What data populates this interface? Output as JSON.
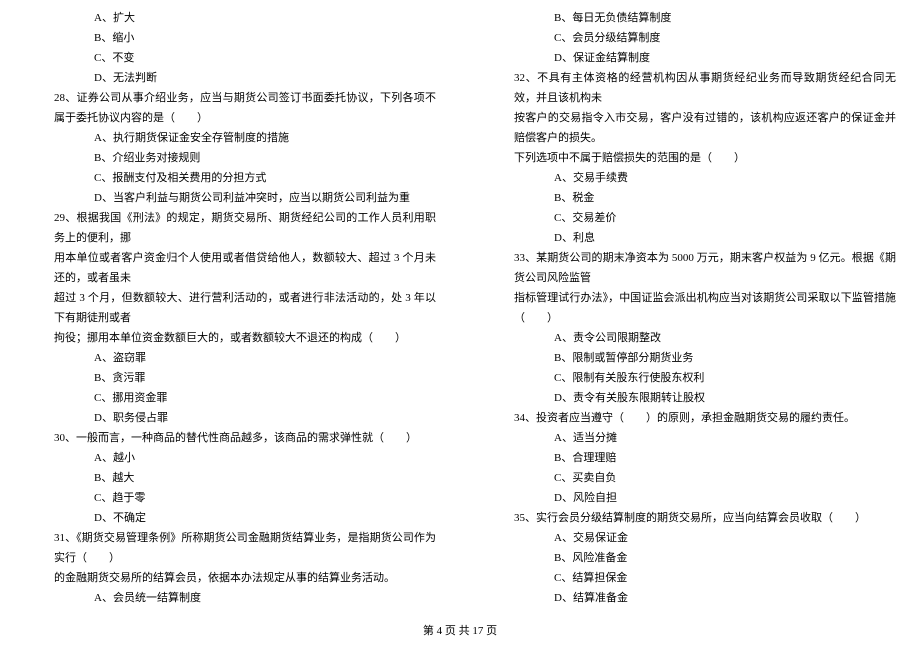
{
  "left_column": {
    "q27_options": [
      "A、扩大",
      "B、缩小",
      "C、不变",
      "D、无法判断"
    ],
    "q28": {
      "text": "28、证券公司从事介绍业务，应当与期货公司签订书面委托协议，下列各项不属于委托协议内容的是（　　）",
      "options": [
        "A、执行期货保证金安全存管制度的措施",
        "B、介绍业务对接规则",
        "C、报酬支付及相关费用的分担方式",
        "D、当客户利益与期货公司利益冲突时，应当以期货公司利益为重"
      ]
    },
    "q29": {
      "lines": [
        "29、根据我国《刑法》的规定，期货交易所、期货经纪公司的工作人员利用职务上的便利，挪",
        "用本单位或者客户资金归个人使用或者借贷给他人，数额较大、超过 3 个月未还的，或者虽未",
        "超过 3 个月，但数额较大、进行营利活动的，或者进行非法活动的，处 3 年以下有期徒刑或者",
        "拘役；挪用本单位资金数额巨大的，或者数额较大不退还的构成（　　）"
      ],
      "options": [
        "A、盗窃罪",
        "B、贪污罪",
        "C、挪用资金罪",
        "D、职务侵占罪"
      ]
    },
    "q30": {
      "text": "30、一般而言，一种商品的替代性商品越多，该商品的需求弹性就（　　）",
      "options": [
        "A、越小",
        "B、越大",
        "C、趋于零",
        "D、不确定"
      ]
    },
    "q31": {
      "lines": [
        "31、《期货交易管理条例》所称期货公司金融期货结算业务，是指期货公司作为实行（　　）",
        "的金融期货交易所的结算会员，依据本办法规定从事的结算业务活动。"
      ],
      "options": [
        "A、会员统一结算制度"
      ]
    }
  },
  "right_column": {
    "q31_options_cont": [
      "B、每日无负债结算制度",
      "C、会员分级结算制度",
      "D、保证金结算制度"
    ],
    "q32": {
      "lines": [
        "32、不具有主体资格的经营机构因从事期货经纪业务而导致期货经纪合同无效，并且该机构未",
        "按客户的交易指令入市交易，客户没有过错的，该机构应返还客户的保证金并赔偿客户的损失。",
        "下列选项中不属于赔偿损失的范围的是（　　）"
      ],
      "options": [
        "A、交易手续费",
        "B、税金",
        "C、交易差价",
        "D、利息"
      ]
    },
    "q33": {
      "lines": [
        "33、某期货公司的期末净资本为 5000 万元，期末客户权益为 9 亿元。根据《期货公司风险监管",
        "指标管理试行办法》，中国证监会派出机构应当对该期货公司采取以下监管措施（　　）"
      ],
      "options": [
        "A、责令公司限期整改",
        "B、限制或暂停部分期货业务",
        "C、限制有关股东行使股东权利",
        "D、责令有关股东限期转让股权"
      ]
    },
    "q34": {
      "text": "34、投资者应当遵守（　　）的原则，承担金融期货交易的履约责任。",
      "options": [
        "A、适当分摊",
        "B、合理理赔",
        "C、买卖自负",
        "D、风险自担"
      ]
    },
    "q35": {
      "text": "35、实行会员分级结算制度的期货交易所，应当向结算会员收取（　　）",
      "options": [
        "A、交易保证金",
        "B、风险准备金",
        "C、结算担保金",
        "D、结算准备金"
      ]
    }
  },
  "footer": "第 4 页 共 17 页"
}
